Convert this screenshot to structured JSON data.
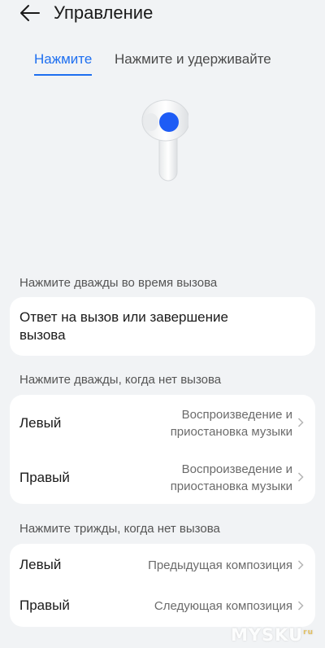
{
  "header": {
    "title": "Управление"
  },
  "tabs": [
    {
      "label": "Нажмите",
      "active": true
    },
    {
      "label": "Нажмите и удерживайте",
      "active": false
    }
  ],
  "colors": {
    "accent": "#1e6ff0",
    "background": "#f1f3f5",
    "card": "#ffffff"
  },
  "sections": [
    {
      "label": "Нажмите дважды во время вызова",
      "rows": [
        {
          "label": "Ответ на вызов или завершение вызова"
        }
      ]
    },
    {
      "label": "Нажмите дважды, когда нет вызова",
      "rows": [
        {
          "label": "Левый",
          "value": "Воспроизведение и приостановка музыки"
        },
        {
          "label": "Правый",
          "value": "Воспроизведение и приостановка музыки"
        }
      ]
    },
    {
      "label": "Нажмите трижды, когда нет вызова",
      "rows": [
        {
          "label": "Левый",
          "value": "Предыдущая композиция"
        },
        {
          "label": "Правый",
          "value": "Следующая композиция"
        }
      ]
    }
  ],
  "watermark": {
    "text": "MYSKU",
    "suffix": "ru"
  }
}
